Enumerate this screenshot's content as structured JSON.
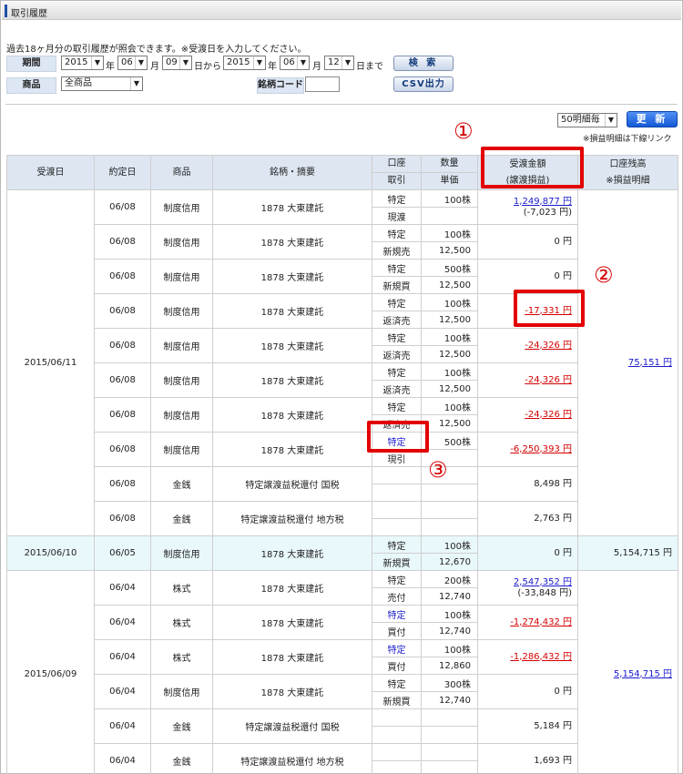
{
  "window": {
    "title": "取引履歴"
  },
  "notice": "過去18ヶ月分の取引履歴が照会できます。※受渡日を入力してください。",
  "filters": {
    "period_label": "期間",
    "from_year": "2015",
    "from_month": "06",
    "from_day": "09",
    "to_year": "2015",
    "to_month": "06",
    "to_day": "12",
    "unit_year": "年",
    "unit_month": "月",
    "unit_from": "日から",
    "unit_to": "日まで",
    "search_button": "検 索",
    "product_label": "商品",
    "product_value": "全商品",
    "code_label": "銘柄コード",
    "code_value": "",
    "csv_button": "CSV出力"
  },
  "list_controls": {
    "page_size": "50明細毎",
    "refresh_button": "更 新",
    "note": "※損益明細は下線リンク"
  },
  "annotations": {
    "c1": "①",
    "c2": "②",
    "c3": "③"
  },
  "table": {
    "headers": {
      "date": "受渡日",
      "trade_date": "約定日",
      "product": "商品",
      "name": "銘柄・摘要",
      "account": "口座",
      "txn": "取引",
      "qty": "数量",
      "price": "単価",
      "amount1": "受渡金額",
      "amount2": "(譲渡損益)",
      "balance1": "口座残高",
      "balance2": "※損益明細"
    },
    "groups": [
      {
        "date": "2015/06/11",
        "balance": "75,151 円",
        "balance_link": true,
        "rows": [
          {
            "trade_date": "06/08",
            "product": "制度信用",
            "name": "1878 大東建託",
            "account": "特定",
            "account_blue": false,
            "txn": "現渡",
            "qty": "100株",
            "price": "",
            "amount": "1,249,877 円",
            "amount_style": "blue",
            "sub": "(-7,023 円)"
          },
          {
            "trade_date": "06/08",
            "product": "制度信用",
            "name": "1878 大東建託",
            "account": "特定",
            "account_blue": false,
            "txn": "新規売",
            "qty": "100株",
            "price": "12,500",
            "amount": "0 円",
            "amount_style": "",
            "sub": ""
          },
          {
            "trade_date": "06/08",
            "product": "制度信用",
            "name": "1878 大東建託",
            "account": "特定",
            "account_blue": false,
            "txn": "新規買",
            "qty": "500株",
            "price": "12,500",
            "amount": "0 円",
            "amount_style": "",
            "sub": ""
          },
          {
            "trade_date": "06/08",
            "product": "制度信用",
            "name": "1878 大東建託",
            "account": "特定",
            "account_blue": false,
            "txn": "返済売",
            "qty": "100株",
            "price": "12,500",
            "amount": "-17,331 円",
            "amount_style": "red",
            "sub": ""
          },
          {
            "trade_date": "06/08",
            "product": "制度信用",
            "name": "1878 大東建託",
            "account": "特定",
            "account_blue": false,
            "txn": "返済売",
            "qty": "100株",
            "price": "12,500",
            "amount": "-24,326 円",
            "amount_style": "red",
            "sub": ""
          },
          {
            "trade_date": "06/08",
            "product": "制度信用",
            "name": "1878 大東建託",
            "account": "特定",
            "account_blue": false,
            "txn": "返済売",
            "qty": "100株",
            "price": "12,500",
            "amount": "-24,326 円",
            "amount_style": "red",
            "sub": ""
          },
          {
            "trade_date": "06/08",
            "product": "制度信用",
            "name": "1878 大東建託",
            "account": "特定",
            "account_blue": false,
            "txn": "返済売",
            "qty": "100株",
            "price": "12,500",
            "amount": "-24,326 円",
            "amount_style": "red",
            "sub": ""
          },
          {
            "trade_date": "06/08",
            "product": "制度信用",
            "name": "1878 大東建託",
            "account": "特定",
            "account_blue": true,
            "txn": "現引",
            "qty": "500株",
            "price": "",
            "amount": "-6,250,393 円",
            "amount_style": "red",
            "sub": ""
          },
          {
            "trade_date": "06/08",
            "product": "金銭",
            "name": "特定譲渡益税還付 国税",
            "account": "",
            "account_blue": false,
            "txn": "",
            "qty": "",
            "price": "",
            "amount": "8,498 円",
            "amount_style": "",
            "sub": ""
          },
          {
            "trade_date": "06/08",
            "product": "金銭",
            "name": "特定譲渡益税還付 地方税",
            "account": "",
            "account_blue": false,
            "txn": "",
            "qty": "",
            "price": "",
            "amount": "2,763 円",
            "amount_style": "",
            "sub": ""
          }
        ]
      },
      {
        "date": "2015/06/10",
        "balance": "5,154,715 円",
        "balance_link": false,
        "highlight": true,
        "rows": [
          {
            "trade_date": "06/05",
            "product": "制度信用",
            "name": "1878 大東建託",
            "account": "特定",
            "account_blue": false,
            "txn": "新規買",
            "qty": "100株",
            "price": "12,670",
            "amount": "0 円",
            "amount_style": "",
            "sub": ""
          }
        ]
      },
      {
        "date": "2015/06/09",
        "balance": "5,154,715 円",
        "balance_link": true,
        "rows": [
          {
            "trade_date": "06/04",
            "product": "株式",
            "name": "1878 大東建託",
            "account": "特定",
            "account_blue": false,
            "txn": "売付",
            "qty": "200株",
            "price": "12,740",
            "amount": "2,547,352 円",
            "amount_style": "blue",
            "sub": "(-33,848 円)"
          },
          {
            "trade_date": "06/04",
            "product": "株式",
            "name": "1878 大東建託",
            "account": "特定",
            "account_blue": true,
            "txn": "買付",
            "qty": "100株",
            "price": "12,740",
            "amount": "-1,274,432 円",
            "amount_style": "red",
            "sub": ""
          },
          {
            "trade_date": "06/04",
            "product": "株式",
            "name": "1878 大東建託",
            "account": "特定",
            "account_blue": true,
            "txn": "買付",
            "qty": "100株",
            "price": "12,860",
            "amount": "-1,286,432 円",
            "amount_style": "red",
            "sub": ""
          },
          {
            "trade_date": "06/04",
            "product": "制度信用",
            "name": "1878 大東建託",
            "account": "特定",
            "account_blue": false,
            "txn": "新規買",
            "qty": "300株",
            "price": "12,740",
            "amount": "0 円",
            "amount_style": "",
            "sub": ""
          },
          {
            "trade_date": "06/04",
            "product": "金銭",
            "name": "特定譲渡益税還付 国税",
            "account": "",
            "account_blue": false,
            "txn": "",
            "qty": "",
            "price": "",
            "amount": "5,184 円",
            "amount_style": "",
            "sub": ""
          },
          {
            "trade_date": "06/04",
            "product": "金銭",
            "name": "特定譲渡益税還付 地方税",
            "account": "",
            "account_blue": false,
            "txn": "",
            "qty": "",
            "price": "",
            "amount": "1,693 円",
            "amount_style": "",
            "sub": ""
          }
        ]
      }
    ]
  }
}
